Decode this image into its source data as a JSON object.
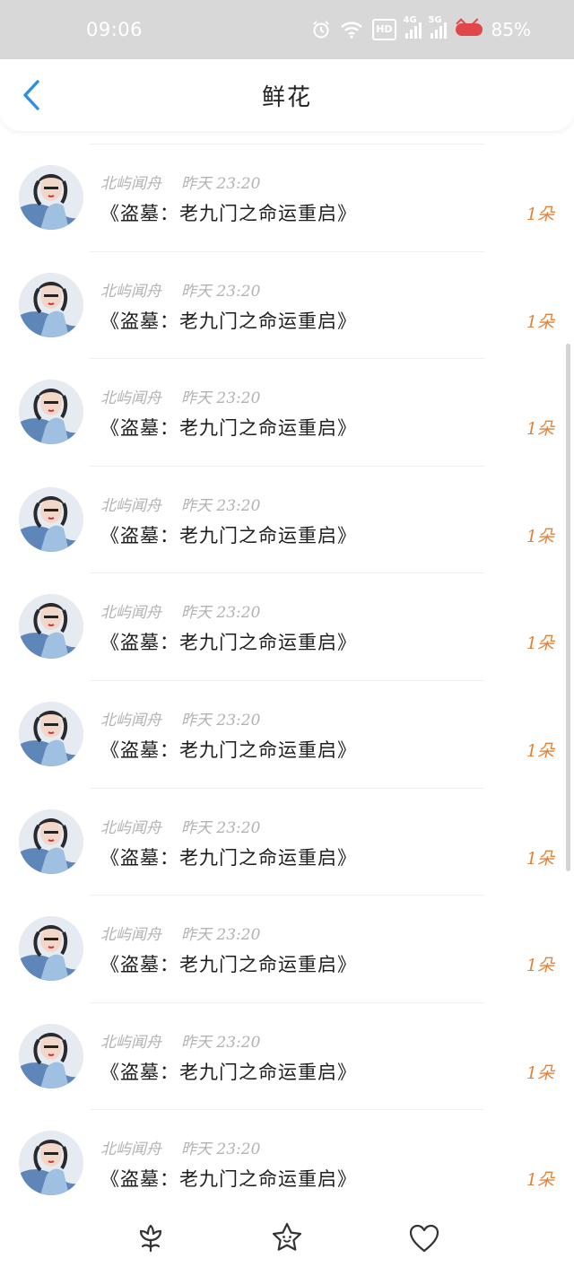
{
  "status_bar": {
    "time": "09:06",
    "hd_badge": "HD",
    "net_4g": "4G",
    "net_5g": "5G",
    "battery": "85%"
  },
  "header": {
    "title": "鲜花"
  },
  "items": [
    {
      "name": "北屿闻舟",
      "time": "昨天 23:20",
      "title": "《盗墓：老九门之命运重启》",
      "count": "1朵"
    },
    {
      "name": "北屿闻舟",
      "time": "昨天 23:20",
      "title": "《盗墓：老九门之命运重启》",
      "count": "1朵"
    },
    {
      "name": "北屿闻舟",
      "time": "昨天 23:20",
      "title": "《盗墓：老九门之命运重启》",
      "count": "1朵"
    },
    {
      "name": "北屿闻舟",
      "time": "昨天 23:20",
      "title": "《盗墓：老九门之命运重启》",
      "count": "1朵"
    },
    {
      "name": "北屿闻舟",
      "time": "昨天 23:20",
      "title": "《盗墓：老九门之命运重启》",
      "count": "1朵"
    },
    {
      "name": "北屿闻舟",
      "time": "昨天 23:20",
      "title": "《盗墓：老九门之命运重启》",
      "count": "1朵"
    },
    {
      "name": "北屿闻舟",
      "time": "昨天 23:20",
      "title": "《盗墓：老九门之命运重启》",
      "count": "1朵"
    },
    {
      "name": "北屿闻舟",
      "time": "昨天 23:20",
      "title": "《盗墓：老九门之命运重启》",
      "count": "1朵"
    },
    {
      "name": "北屿闻舟",
      "time": "昨天 23:20",
      "title": "《盗墓：老九门之命运重启》",
      "count": "1朵"
    },
    {
      "name": "北屿闻舟",
      "time": "昨天 23:20",
      "title": "《盗墓：老九门之命运重启》",
      "count": "1朵"
    }
  ],
  "bottom_nav": [
    "flower-icon",
    "star-icon",
    "heart-icon"
  ],
  "colors": {
    "accent_blue": "#2f8fe0",
    "count_orange": "#e0843c",
    "status_bar_bg": "#d8d8d8"
  }
}
